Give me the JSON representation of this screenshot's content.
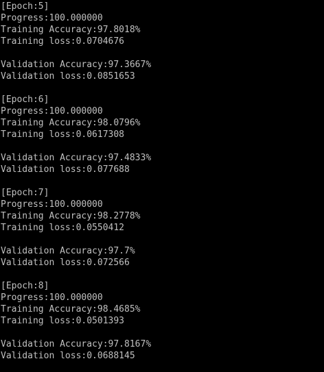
{
  "console": {
    "text_color": "#c0c0c0",
    "background_color": "#000000",
    "epochs": [
      {
        "header": "[Epoch:5]",
        "progress": "Progress:100.000000",
        "train_acc": "Training Accuracy:97.8018%",
        "train_loss": "Training loss:0.0704676",
        "val_acc": "Validation Accuracy:97.3667%",
        "val_loss": "Validation loss:0.0851653"
      },
      {
        "header": "[Epoch:6]",
        "progress": "Progress:100.000000",
        "train_acc": "Training Accuracy:98.0796%",
        "train_loss": "Training loss:0.0617308",
        "val_acc": "Validation Accuracy:97.4833%",
        "val_loss": "Validation loss:0.077688"
      },
      {
        "header": "[Epoch:7]",
        "progress": "Progress:100.000000",
        "train_acc": "Training Accuracy:98.2778%",
        "train_loss": "Training loss:0.0550412",
        "val_acc": "Validation Accuracy:97.7%",
        "val_loss": "Validation loss:0.072566"
      },
      {
        "header": "[Epoch:8]",
        "progress": "Progress:100.000000",
        "train_acc": "Training Accuracy:98.4685%",
        "train_loss": "Training loss:0.0501393",
        "val_acc": "Validation Accuracy:97.8167%",
        "val_loss": "Validation loss:0.0688145"
      }
    ]
  }
}
